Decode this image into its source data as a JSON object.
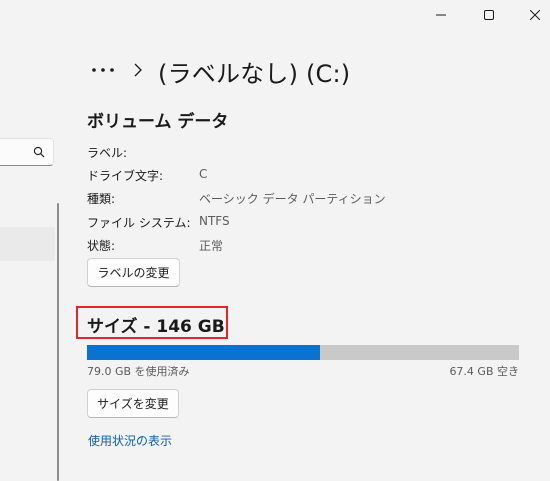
{
  "window_controls": {
    "minimize_icon": "minimize-icon",
    "maximize_icon": "maximize-icon",
    "close_icon": "close-icon"
  },
  "sidebar": {
    "search_icon": "search-icon"
  },
  "breadcrumb": {
    "more_icon": "more-horizontal-icon",
    "separator_icon": "chevron-right-icon",
    "title": "(ラベルなし) (C:)"
  },
  "volume_data": {
    "heading": "ボリューム データ",
    "properties": [
      {
        "label": "ラベル:",
        "value": ""
      },
      {
        "label": "ドライブ文字:",
        "value": "C"
      },
      {
        "label": "種類:",
        "value": "ベーシック データ パーティション"
      },
      {
        "label": "ファイル システム:",
        "value": "NTFS"
      },
      {
        "label": "状態:",
        "value": "正常"
      }
    ],
    "change_label_button": "ラベルの変更"
  },
  "size": {
    "heading": "サイズ - 146 GB",
    "used_fraction": 0.54,
    "used_text": "79.0 GB を使用済み",
    "free_text": "67.4 GB 空き",
    "resize_button": "サイズを変更",
    "usage_link": "使用状況の表示"
  },
  "colors": {
    "accent": "#0a72d1",
    "bar_track": "#c9c9c9",
    "highlight": "#e3262d",
    "link": "#0d5fb0",
    "background": "#f3f3f3"
  }
}
